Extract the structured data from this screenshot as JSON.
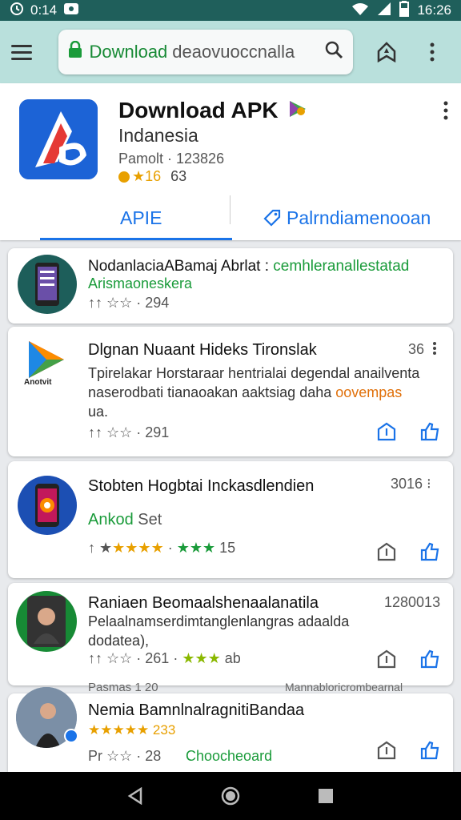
{
  "status_bar": {
    "left_time": "0:14",
    "time": "16:26"
  },
  "url_bar": {
    "green_text": "Download",
    "grey_text": "deaovuoccnalla"
  },
  "header": {
    "title": "Download APK",
    "subtitle": "Indanesia",
    "meta": "Pamolt · 123826",
    "rating": "★16",
    "count": "63",
    "tab_left": "APIE",
    "tab_right": "Palrndiamenooan"
  },
  "items": [
    {
      "title": "NodanlaciaABamaj Abrlat :",
      "green_note": "cemhleranallestatad",
      "sub": "Arismaoneskera",
      "meta": "↑↑ ☆☆ · 294"
    },
    {
      "title": "Dlgnan Nuaant Hideks Tironslak",
      "right_count": "36",
      "desc1": "Tpirelakar Horstaraar hentrialai degendal anailventa",
      "desc2": "naserodbati tianaoakan aaktsiag daha",
      "orange": "oovempas",
      "desc3": "ua.",
      "meta": "↑↑ ☆☆ · 291",
      "icon_label": "Anotvit"
    },
    {
      "title": "Stobten Hogbtai Inckasdlendien",
      "right_count": "3016",
      "green": "Ankod",
      "green_sub": "Set",
      "meta_num": "15"
    },
    {
      "title": "Raniaen Beomaalshenaalanatila",
      "right_count": "1280013",
      "desc1": "Pelaalnamserdimtanglenlangras adaalda",
      "desc2": "dodatea),",
      "meta": "↑↑ ☆☆ · 261",
      "meta_end": "ab"
    },
    {
      "peek_left": "Pasmas 1 20",
      "peek_right": "Mannabloricrombearnal",
      "title": "Nemia BamnlnalragnitiBandaa",
      "rating": "★★★★★ 233",
      "meta": "Pr ☆☆ · 28",
      "green": "Choocheoard"
    }
  ]
}
